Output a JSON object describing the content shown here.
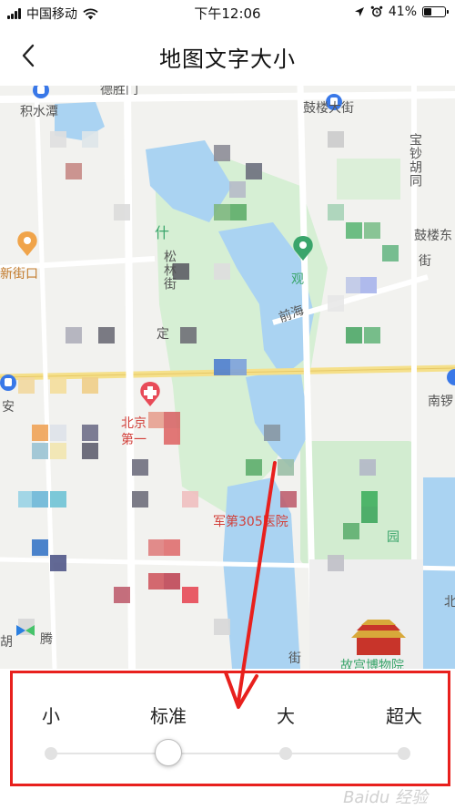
{
  "status_bar": {
    "carrier": "中国移动",
    "time": "下午12:06",
    "battery": "41%",
    "battery_level": 0.41,
    "icons": [
      "signal-bars-icon",
      "wifi-icon",
      "location-arrow-icon",
      "alarm-clock-icon",
      "battery-icon"
    ]
  },
  "nav": {
    "back_icon": "chevron-left-icon",
    "title": "地图文字大小"
  },
  "map": {
    "labels": {
      "jishuitan": "积水潭",
      "deshengmen": "德胜门",
      "gulou_dajie": "鼓楼大街",
      "baochao_hutong": "宝钞胡同",
      "gulou_dong": "鼓楼东",
      "shi": "什",
      "song": "松林街",
      "jiekou": "新街口",
      "guan": "观",
      "qianhai": "前海",
      "jie": "街",
      "ding": "定",
      "an": "安",
      "nanluo": "南锣",
      "beijing": "北京",
      "di1": "第一",
      "hospital": "军第305医院",
      "yuan": "园",
      "hu": "胡",
      "teng": "腾",
      "bei": "北",
      "jie2": "街",
      "palace": "故宫博物院"
    },
    "icons": [
      "subway-icon",
      "hospital-icon",
      "scenic-spot-icon",
      "location-pin-icon",
      "palace-icon",
      "app-logo-icon"
    ]
  },
  "font_size": {
    "options": [
      "小",
      "标准",
      "大",
      "超大"
    ],
    "selected_index": 1,
    "selected": "标准"
  },
  "watermark": "Baidu 经验",
  "colors": {
    "water": "#aad3f2",
    "park": "#cdeccf",
    "annotation": "#e8201d"
  }
}
